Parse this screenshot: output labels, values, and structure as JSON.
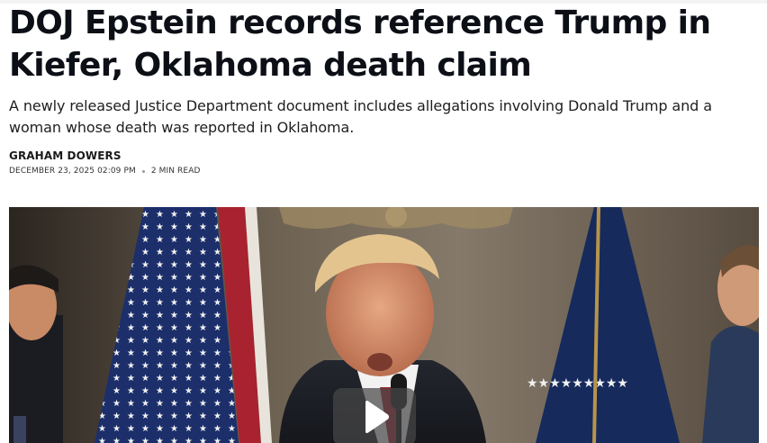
{
  "article": {
    "headline": "DOJ Epstein records reference Trump in Kiefer, Oklahoma death claim",
    "dek": "A newly released Justice Department document includes allegations involving Donald Trump and a woman whose death was reported in Oklahoma.",
    "author": "GRAHAM DOWERS",
    "date": "DECEMBER 23, 2025 02:09 PM",
    "read_time": "2 MIN READ"
  },
  "video": {
    "play_icon": "play-icon"
  },
  "colors": {
    "headline": "#0c0f16",
    "play_overlay": "#464646",
    "flag_blue": "#1c2f6b",
    "flag_red": "#a8232f"
  }
}
